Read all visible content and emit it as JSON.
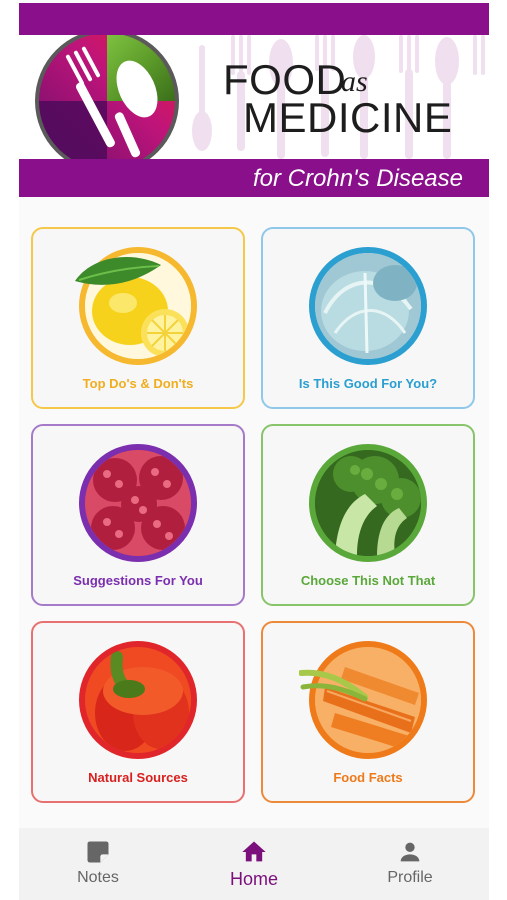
{
  "colors": {
    "brand_purple": "#8a0f8a",
    "nav_active": "#7b0f7b",
    "nav_inactive": "#666666"
  },
  "header": {
    "title_line1": "FOOD",
    "title_as": "as",
    "title_line2": "MEDICINE",
    "subtitle": "for Crohn's Disease",
    "logo_icon": "fork-and-spoon-icon"
  },
  "tiles": [
    {
      "label": "Top Do's & Don'ts",
      "icon": "lemon-icon",
      "color": "#f5b82e"
    },
    {
      "label": "Is This Good For You?",
      "icon": "cabbage-icon",
      "color": "#2a9fd0"
    },
    {
      "label": "Suggestions For You",
      "icon": "raspberry-icon",
      "color": "#7b2fae"
    },
    {
      "label": "Choose This Not That",
      "icon": "broccoli-icon",
      "color": "#5aa83a"
    },
    {
      "label": "Natural Sources",
      "icon": "red-pepper-icon",
      "color": "#e0262b"
    },
    {
      "label": "Food Facts",
      "icon": "carrot-icon",
      "color": "#ef7a1a"
    }
  ],
  "nav": {
    "items": [
      {
        "label": "Notes",
        "icon": "note-icon",
        "active": false
      },
      {
        "label": "Home",
        "icon": "home-icon",
        "active": true
      },
      {
        "label": "Profile",
        "icon": "person-icon",
        "active": false
      }
    ]
  }
}
